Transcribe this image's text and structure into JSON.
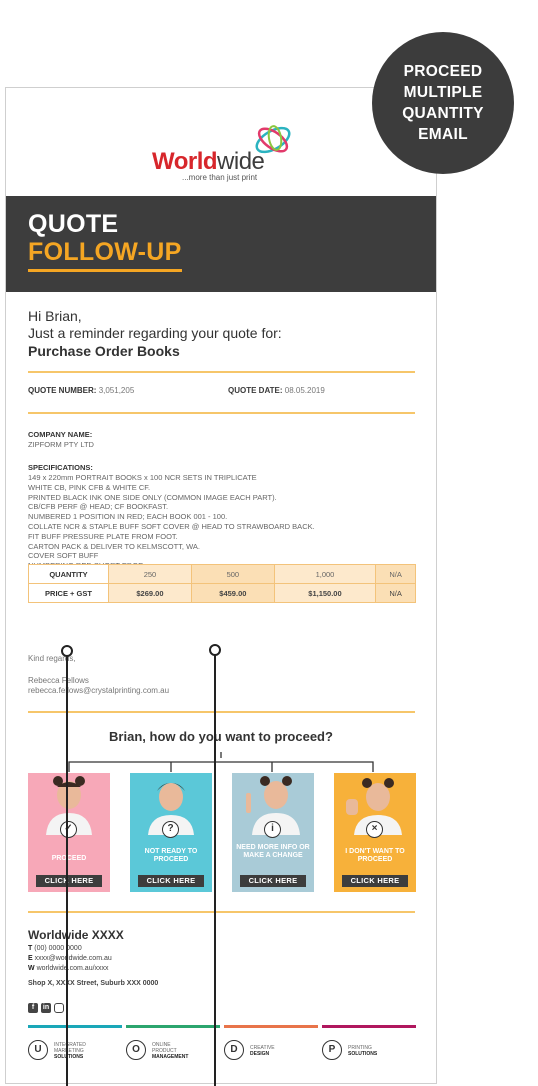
{
  "badge": {
    "lines": [
      "PROCEED",
      "MULTIPLE",
      "QUANTITY",
      "EMAIL"
    ]
  },
  "logo": {
    "word_a": "World",
    "word_b": "wide",
    "tagline": "...more than just print"
  },
  "hero": {
    "line1": "QUOTE",
    "line2": "FOLLOW-UP"
  },
  "greeting": {
    "hi": "Hi Brian,",
    "reminder": "Just a reminder regarding your quote for:",
    "product": "Purchase Order Books"
  },
  "quote": {
    "number_label": "QUOTE NUMBER:",
    "number": "3,051,205",
    "date_label": "QUOTE DATE:",
    "date": "08.05.2019"
  },
  "company": {
    "label": "COMPANY NAME:",
    "value": "ZIPFORM PTY LTD"
  },
  "specs": {
    "label": "SPECIFICATIONS:",
    "lines": [
      "149 x 220mm PORTRAIT BOOKS x 100 NCR SETS IN TRIPLICATE",
      "WHITE CB, PINK CFB & WHITE CF.",
      "PRINTED BLACK INK ONE SIDE ONLY (COMMON IMAGE EACH PART).",
      "CB/CFB PERF @ HEAD; CF BOOKFAST.",
      "NUMBERED 1 POSITION IN RED; EACH BOOK 001 - 100.",
      "COLLATE NCR & STAPLE BUFF SOFT COVER @ HEAD TO STRAWBOARD BACK.",
      "FIT BUFF PRESSURE PLATE FROM FOOT.",
      "CARTON PACK & DELIVER TO KELMSCOTT, WA.",
      "COVER SOFT BUFF",
      "NUMBERING RED SHORT EDGE"
    ]
  },
  "table": {
    "qty_label": "QUANTITY",
    "price_label": "PRICE + GST",
    "quantities": [
      "250",
      "500",
      "1,000",
      "N/A"
    ],
    "prices": [
      "$269.00",
      "$459.00",
      "$1,150.00",
      "N/A"
    ]
  },
  "signoff": {
    "regards": "Kind regards,",
    "name": "Rebecca Fellows",
    "email": "rebecca.fellows@crystalprinting.com.au"
  },
  "proceed": {
    "heading": "Brian, how do you want to proceed?",
    "cards": [
      {
        "label": "PROCEED",
        "button": "CLICK HERE",
        "icon": "check-icon",
        "glyph": "✓",
        "color": "#f7a8b8"
      },
      {
        "label": "NOT READY TO PROCEED",
        "button": "CLICK HERE",
        "icon": "question-icon",
        "glyph": "?",
        "color": "#5bc8d8"
      },
      {
        "label": "NEED MORE INFO OR MAKE A CHANGE",
        "button": "CLICK HERE",
        "icon": "info-icon",
        "glyph": "i",
        "color": "#a9cbd7"
      },
      {
        "label": "I DON'T WANT TO PROCEED",
        "button": "CLICK HERE",
        "icon": "x-icon",
        "glyph": "×",
        "color": "#f7b13a"
      }
    ]
  },
  "footer": {
    "title": "Worldwide XXXX",
    "phone_label": "T",
    "phone": "(00) 0000 0000",
    "email_label": "E",
    "email": "xxxx@worldwide.com.au",
    "web_label": "W",
    "web": "worldwide.com.au/xxxx",
    "address": "Shop X, XXXX Street, Suburb XXX 0000",
    "socials": [
      "facebook-icon",
      "linkedin-icon",
      "instagram-icon"
    ]
  },
  "services": [
    {
      "letter": "U",
      "line1": "INTEGRATED",
      "line2": "MARKETING",
      "line3": "SOLUTIONS",
      "color": "#1aa7b8"
    },
    {
      "letter": "O",
      "line1": "ONLINE",
      "line2": "PRODUCT",
      "line3": "MANAGEMENT",
      "color": "#2ba56e"
    },
    {
      "letter": "D",
      "line1": "CREATIVE",
      "line2": "",
      "line3": "DESIGN",
      "color": "#e8744a"
    },
    {
      "letter": "P",
      "line1": "PRINTING",
      "line2": "",
      "line3": "SOLUTIONS",
      "color": "#b0175e"
    }
  ]
}
